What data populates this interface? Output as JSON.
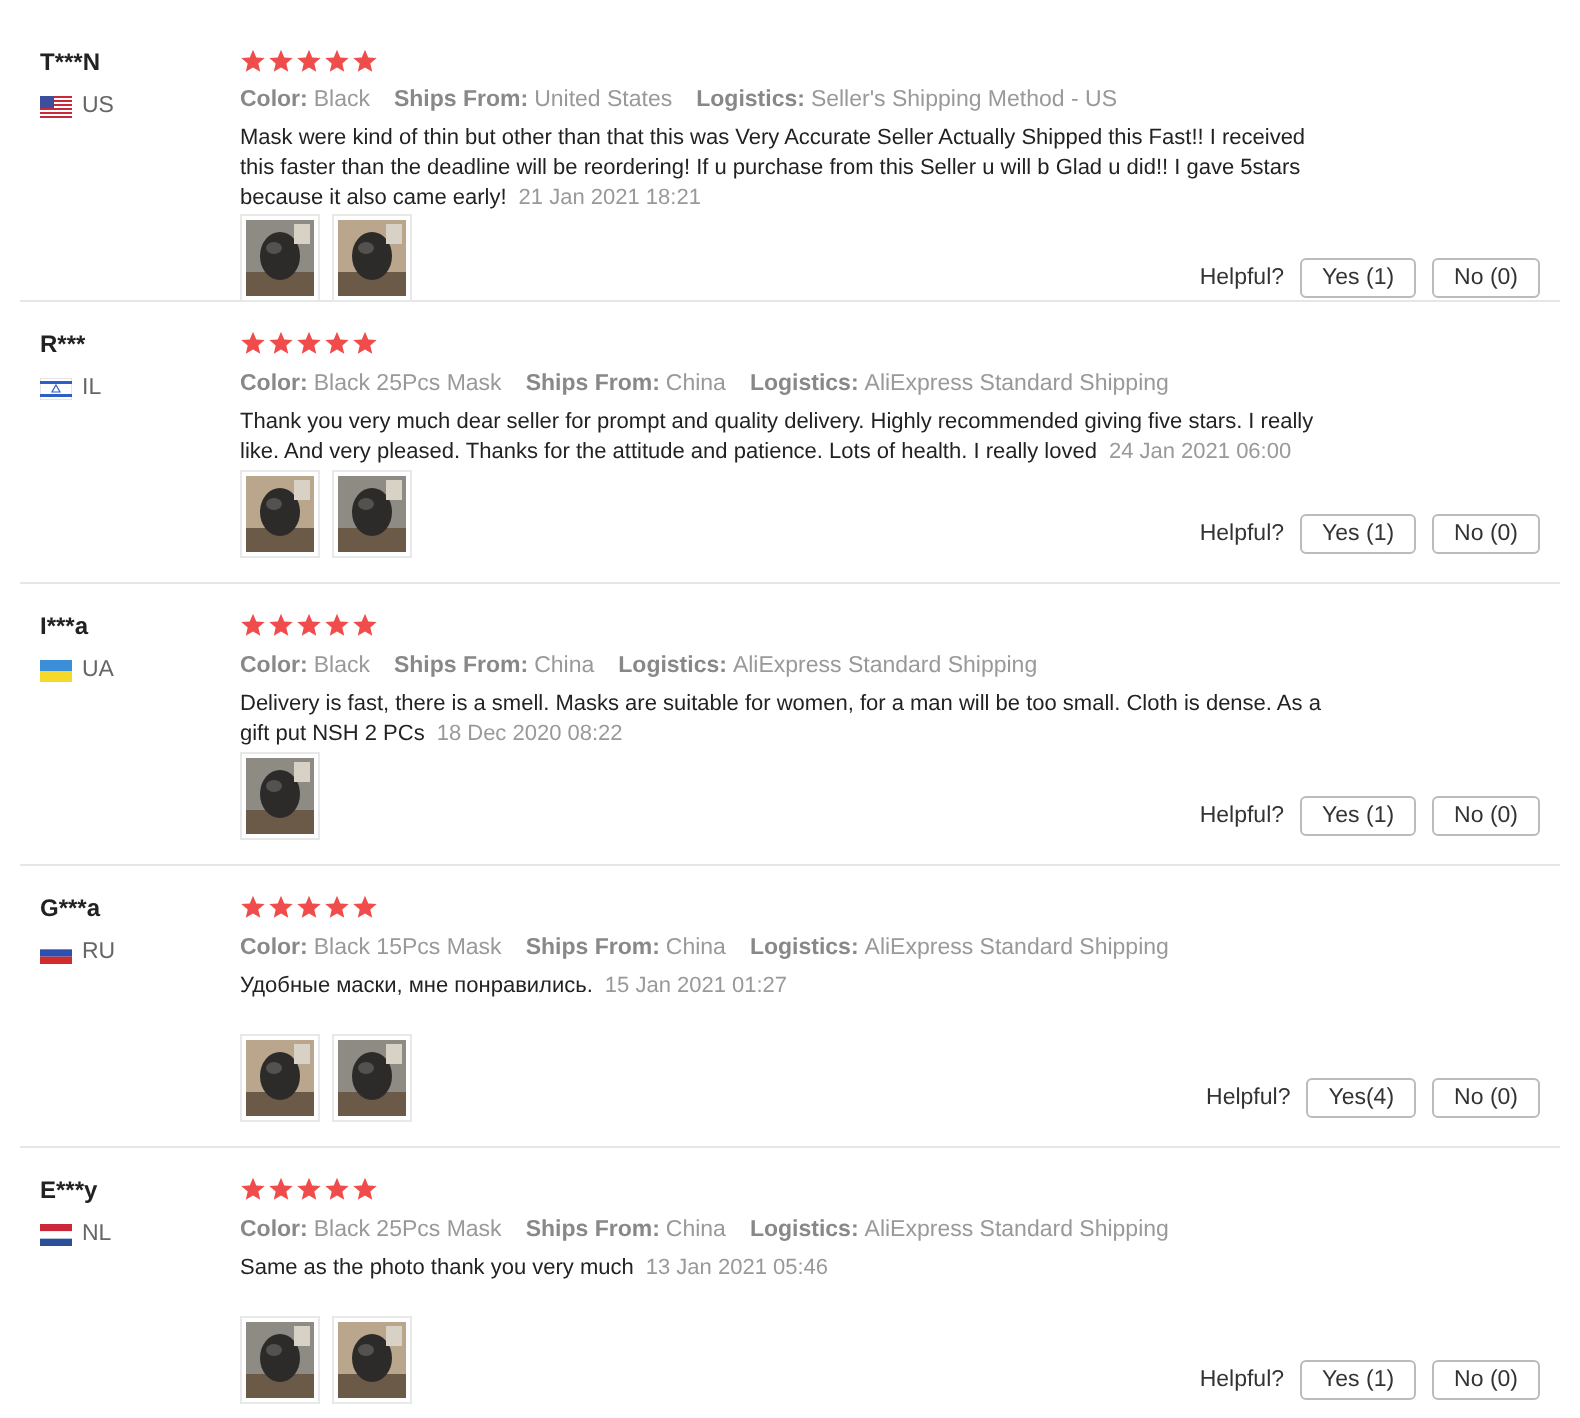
{
  "reviews": [
    {
      "name": "T***N",
      "country": "US",
      "kind": "us",
      "stars": 5,
      "attributes": [
        {
          "label": "Color:",
          "value": "Black"
        },
        {
          "label": "Ships From:",
          "value": "United States"
        },
        {
          "label": "Logistics:",
          "value": "Seller's Shipping Method - US"
        }
      ],
      "text": "Mask were kind of thin but other than that this was Very Accurate Seller Actually Shipped this Fast!! I received this faster than the deadline will be reordering! If u purchase from this Seller u will b Glad u did!! I gave 5stars because it also came early!",
      "date": "21 Jan 2021 18:21",
      "photos": [
        {
          "kind": "picture"
        },
        {
          "kind": "picture"
        }
      ],
      "helpful": "Helpful?",
      "yes": "Yes (1)",
      "no": "No (0)"
    },
    {
      "name": "R***",
      "country": "IL",
      "kind": "il",
      "stars": 5,
      "attributes": [
        {
          "label": "Color:",
          "value": "Black 25Pcs Mask"
        },
        {
          "label": "Ships From:",
          "value": "China"
        },
        {
          "label": "Logistics:",
          "value": "AliExpress Standard Shipping"
        }
      ],
      "text": "Thank you very much dear seller for prompt and quality delivery. Highly recommended giving five stars. I really like. And very pleased. Thanks for the attitude and patience. Lots of health. I really loved",
      "date": "24 Jan 2021 06:00",
      "photos": [
        {
          "kind": "picture"
        },
        {
          "kind": "picture"
        }
      ],
      "helpful": "Helpful?",
      "yes": "Yes (1)",
      "no": "No (0)"
    },
    {
      "name": "I***a",
      "country": "UA",
      "kind": "ua",
      "stars": 5,
      "attributes": [
        {
          "label": "Color:",
          "value": "Black"
        },
        {
          "label": "Ships From:",
          "value": "China"
        },
        {
          "label": "Logistics:",
          "value": "AliExpress Standard Shipping"
        }
      ],
      "text": "Delivery is fast, there is a smell. Masks are suitable for women, for a man will be too small. Cloth is dense. As a gift put NSH 2 PCs",
      "date": "18 Dec 2020 08:22",
      "photos": [
        {
          "kind": "picture"
        }
      ],
      "helpful": "Helpful?",
      "yes": "Yes (1)",
      "no": "No (0)"
    },
    {
      "name": "G***a",
      "country": "RU",
      "kind": "ru",
      "stars": 5,
      "attributes": [
        {
          "label": "Color:",
          "value": "Black 15Pcs Mask"
        },
        {
          "label": "Ships From:",
          "value": "China"
        },
        {
          "label": "Logistics:",
          "value": "AliExpress Standard Shipping"
        }
      ],
      "text": "Удобные маски, мне понравились.",
      "date": "15 Jan 2021 01:27",
      "photos": [
        {
          "kind": "picture"
        },
        {
          "kind": "picture"
        }
      ],
      "helpful": "Helpful?",
      "yes": "Yes(4)",
      "no": "No (0)"
    },
    {
      "name": "E***y",
      "country": "NL",
      "kind": "nl",
      "stars": 5,
      "attributes": [
        {
          "label": "Color:",
          "value": "Black 25Pcs Mask"
        },
        {
          "label": "Ships From:",
          "value": "China"
        },
        {
          "label": "Logistics:",
          "value": "AliExpress Standard Shipping"
        }
      ],
      "text": "Same as the photo thank you very much",
      "date": "13 Jan 2021 05:46",
      "photos": [
        {
          "kind": "picture"
        },
        {
          "kind": "picture"
        }
      ],
      "helpful": "Helpful?",
      "yes": "Yes (1)",
      "no": "No (0)"
    }
  ]
}
